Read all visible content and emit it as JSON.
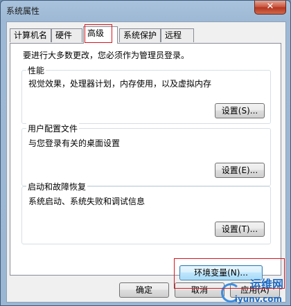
{
  "window": {
    "title": "系统属性",
    "close_label": "✕"
  },
  "tabs": [
    {
      "label": "计算机名"
    },
    {
      "label": "硬件"
    },
    {
      "label": "高级"
    },
    {
      "label": "系统保护"
    },
    {
      "label": "远程"
    }
  ],
  "admin_note": "要进行大多数更改，您必须作为管理员登录。",
  "groups": {
    "performance": {
      "title": "性能",
      "desc": "视觉效果，处理器计划，内存使用，以及虚拟内存",
      "button": "设置(S)..."
    },
    "profiles": {
      "title": "用户配置文件",
      "desc": "与您登录有关的桌面设置",
      "button": "设置(E)..."
    },
    "startup": {
      "title": "启动和故障恢复",
      "desc": "系统启动、系统失败和调试信息",
      "button": "设置(T)..."
    }
  },
  "env_button": "环境变量(N)...",
  "footer": {
    "ok": "确定",
    "cancel": "取消",
    "apply": "应用(A)"
  },
  "watermark": {
    "top": "运维网",
    "bottom": "iyunv.com"
  },
  "colors": {
    "highlight": "#d7141c",
    "focus_border": "#3c7fb1"
  }
}
